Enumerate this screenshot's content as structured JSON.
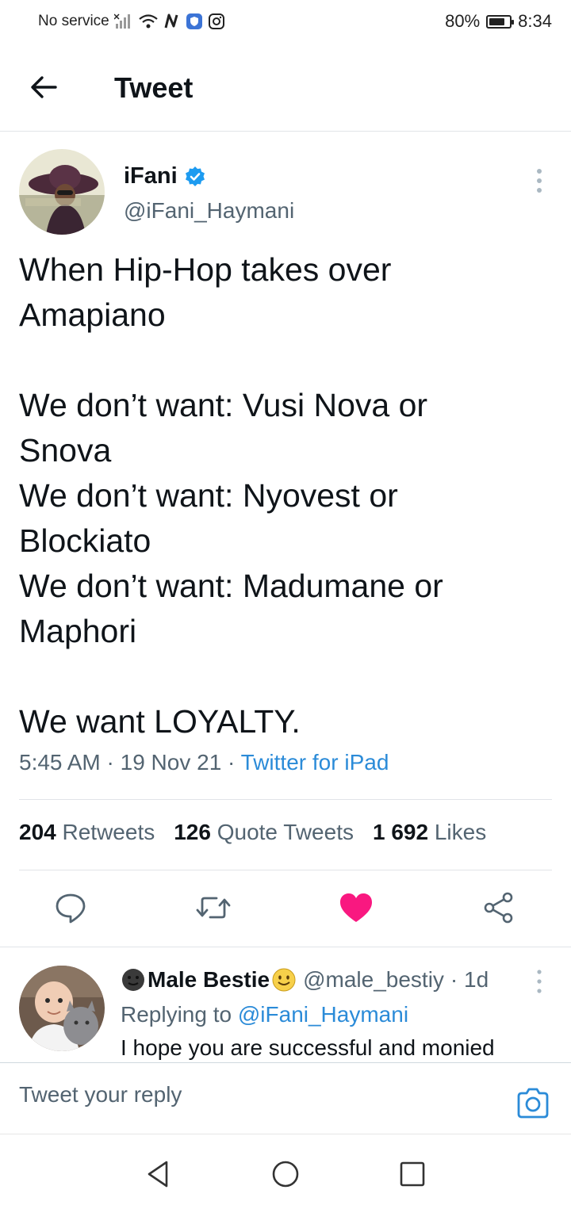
{
  "status_bar": {
    "carrier": "No service",
    "battery": "80%",
    "battery_level": 0.8,
    "time": "8:34"
  },
  "header": {
    "title": "Tweet"
  },
  "tweet": {
    "author_name": "iFani",
    "author_handle": "@iFani_Haymani",
    "verified": true,
    "text": "When Hip-Hop takes over\nAmapiano\n\nWe don’t want: Vusi Nova or\nSnova\nWe don’t want: Nyovest or\nBlockiato\nWe don’t want: Madumane or\nMaphori\n\nWe want LOYALTY.",
    "time": "5:45 AM",
    "date": "19 Nov 21",
    "separator": "·",
    "source": "Twitter for iPad",
    "retweets_count": "204",
    "retweets_label": "Retweets",
    "quotes_count": "126",
    "quotes_label": "Quote Tweets",
    "likes_count": "1 692",
    "likes_label": "Likes",
    "liked": true
  },
  "reply": {
    "name": "Male Bestie",
    "handle": "@male_bestiy",
    "age": "· 1d",
    "replying_prefix": "Replying to",
    "replying_to": "@iFani_Haymani",
    "text": "I hope you are successful and monied"
  },
  "composer": {
    "placeholder": "Tweet your reply"
  },
  "colors": {
    "accent": "#2b8bd8",
    "like": "#f91880",
    "verified": "#1d9bf0",
    "text": "#0f1419",
    "muted": "#536471"
  },
  "icons": {
    "back": "arrow-left-icon",
    "reply": "speech-bubble-icon",
    "retweet": "retweet-icon",
    "like": "heart-icon",
    "share": "share-icon",
    "camera": "camera-icon"
  }
}
